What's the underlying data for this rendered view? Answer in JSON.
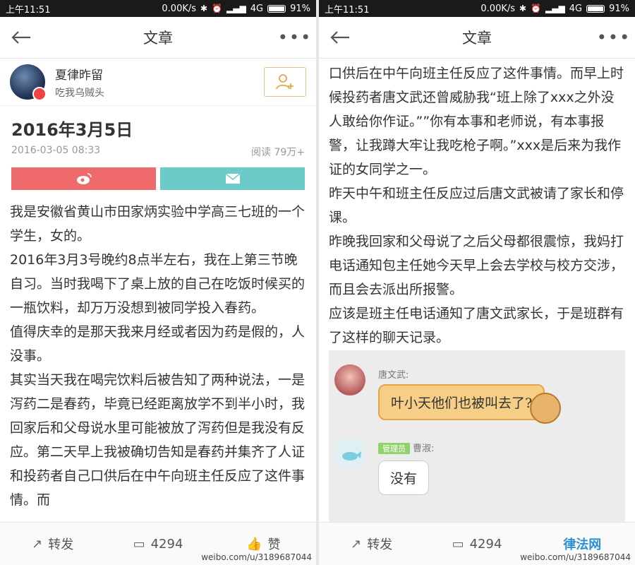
{
  "left": {
    "status": {
      "time": "上午11:51",
      "speed": "0.00K/s",
      "network": "4G",
      "battery": "91%",
      "battery_level": 0.91
    },
    "nav": {
      "title": "文章"
    },
    "author": {
      "name": "夏律昨留",
      "bio": "吃我乌贼头"
    },
    "article": {
      "title": "2016年3月5日",
      "date": "2016-03-05 08:33",
      "reads": "阅读 79万+",
      "paragraphs": [
        "我是安徽省黄山市田家炳实验中学高三七班的一个学生，女的。",
        "2016年3月3号晚约8点半左右，我在上第三节晚自习。当时我喝下了桌上放的自己在吃饭时候买的一瓶饮料，却万万没想到被同学投入春药。",
        "值得庆幸的是那天我来月经或者因为药是假的，人没事。",
        "其实当天我在喝完饮料后被告知了两种说法，一是泻药二是春药，毕竟已经距离放学不到半小时，我回家后和父母说水里可能被放了泻药但是我没有反应。第二天早上我被确切告知是春药并集齐了人证和投药者自己口供后在中午向班主任反应了这件事情。而"
      ]
    },
    "bottom": {
      "repost": "转发",
      "comments": "4294",
      "like": "赞"
    },
    "watermark": "weibo.com/u/3189687044"
  },
  "right": {
    "status": {
      "time": "上午11:51",
      "speed": "0.00K/s",
      "network": "4G",
      "battery": "91%",
      "battery_level": 0.91
    },
    "nav": {
      "title": "文章"
    },
    "paragraphs": [
      "口供后在中午向班主任反应了这件事情。而早上时候投药者唐文武还曾威胁我“班上除了xxx之外没人敢给你作证。””你有本事和老师说，有本事报警，让我蹲大牢让我吃枪子啊。”xxx是后来为我作证的女同学之一。",
      "昨天中午和班主任反应过后唐文武被请了家长和停课。",
      "昨晚我回家和父母说了之后父母都很震惊，我妈打电话通知包主任她今天早上会去学校与校方交涉，而且会去派出所报警。",
      "应该是班主任电话通知了唐文武家长，于是班群有了这样的聊天记录。"
    ],
    "chat": [
      {
        "role": "",
        "name": "唐文武:",
        "text": "叶小天他们也被叫去了?"
      },
      {
        "role": "管理员",
        "name": "曹淑:",
        "text": "没有"
      }
    ],
    "bottom": {
      "repost": "转发",
      "comments": "4294"
    },
    "watermark": "weibo.com/u/3189687044",
    "logo": "律法网"
  }
}
